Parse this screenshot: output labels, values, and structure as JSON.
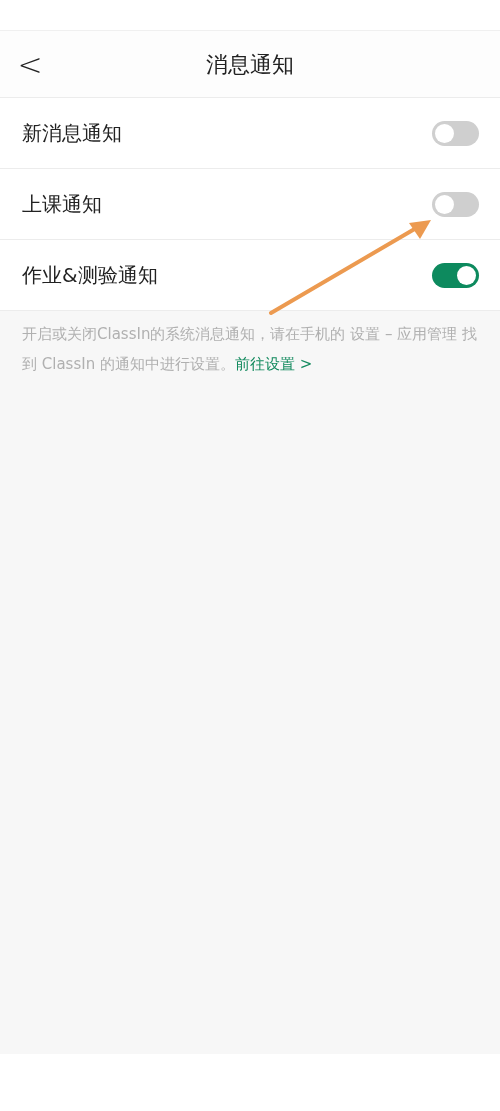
{
  "header": {
    "back": "<",
    "title": "消息通知"
  },
  "settings": [
    {
      "label": "新消息通知",
      "on": false
    },
    {
      "label": "上课通知",
      "on": false
    },
    {
      "label": "作业&测验通知",
      "on": true
    }
  ],
  "note": {
    "text": "开启或关闭ClassIn的系统消息通知，请在手机的 设置 – 应用管理 找到 ClassIn 的通知中进行设置。",
    "link": "前往设置 >"
  }
}
